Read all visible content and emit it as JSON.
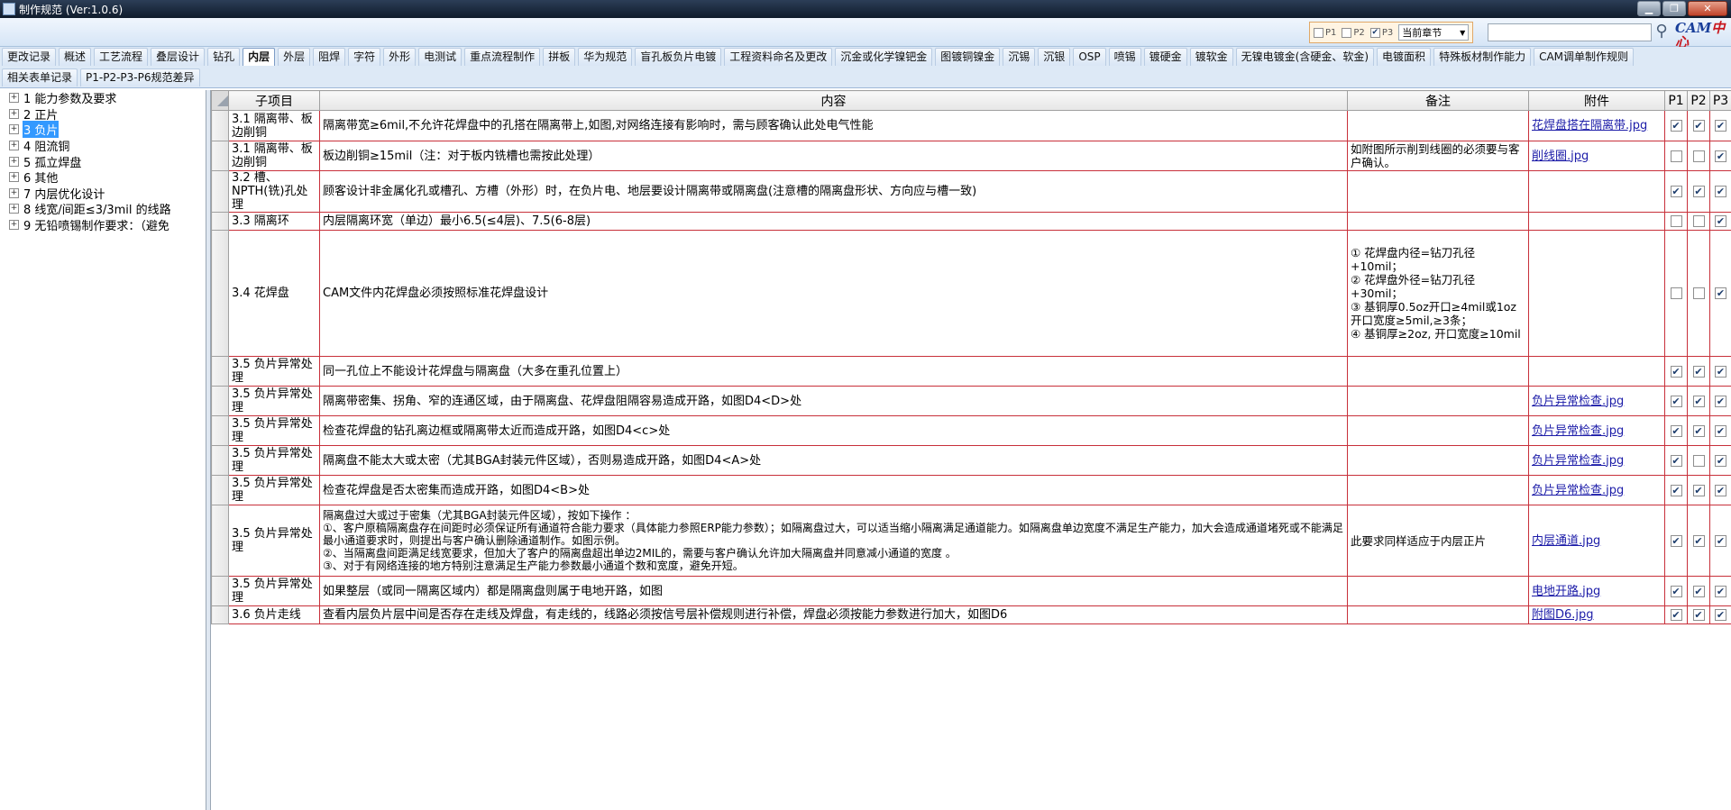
{
  "window": {
    "title": "制作规范 (Ver:1.0.6)"
  },
  "toolbar": {
    "filters": [
      {
        "label": "P1",
        "checked": false
      },
      {
        "label": "P2",
        "checked": false
      },
      {
        "label": "P3",
        "checked": true
      }
    ],
    "chapter_select": "当前章节",
    "search_value": "",
    "logo_text_a": "CAM",
    "logo_text_b": "中心"
  },
  "tabs": {
    "row1": [
      "更改记录",
      "概述",
      "工艺流程",
      "叠层设计",
      "钻孔",
      "内层",
      "外层",
      "阻焊",
      "字符",
      "外形",
      "电测试",
      "重点流程制作",
      "拼板",
      "华为规范",
      "盲孔板负片电镀",
      "工程资料命名及更改",
      "沉金或化学镍钯金",
      "图镀铜镍金",
      "沉锡",
      "沉银",
      "OSP",
      "喷锡",
      "镀硬金",
      "镀软金",
      "无镍电镀金(含硬金、软金)",
      "电镀面积",
      "特殊板材制作能力",
      "CAM调单制作规则"
    ],
    "row2": [
      "相关表单记录",
      "P1-P2-P3-P6规范差异"
    ],
    "active": "内层"
  },
  "tree": {
    "items": [
      {
        "num": "1",
        "label": "能力参数及要求"
      },
      {
        "num": "2",
        "label": "正片"
      },
      {
        "num": "3",
        "label": "负片",
        "selected": true
      },
      {
        "num": "4",
        "label": "阻流铜"
      },
      {
        "num": "5",
        "label": "孤立焊盘"
      },
      {
        "num": "6",
        "label": "其他"
      },
      {
        "num": "7",
        "label": "内层优化设计"
      },
      {
        "num": "8",
        "label": "线宽/间距≤3/3mil 的线路"
      },
      {
        "num": "9",
        "label": "无铅喷锡制作要求：（避免"
      }
    ]
  },
  "grid": {
    "headers": {
      "subitem": "子项目",
      "content": "内容",
      "notes": "备注",
      "attachment": "附件",
      "p1": "P1",
      "p2": "P2",
      "p3": "P3"
    },
    "rows": [
      {
        "subitem": "3.1 隔离带、板边削铜",
        "content": "隔离带宽≥6mil,不允许花焊盘中的孔搭在隔离带上,如图,对网络连接有影响时，需与顾客确认此处电气性能",
        "notes": "",
        "attachment": "花焊盘搭在隔离带.jpg",
        "p1": true,
        "p2": true,
        "p3": true
      },
      {
        "subitem": "3.1 隔离带、板边削铜",
        "content": "板边削铜≥15mil（注：对于板内铣槽也需按此处理）",
        "notes": "如附图所示削到线圈的必须要与客户确认。",
        "attachment": "削线圈.jpg",
        "p1": false,
        "p2": false,
        "p3": true
      },
      {
        "subitem": "3.2 槽、NPTH(铣)孔处理",
        "content": "顾客设计非金属化孔或槽孔、方槽（外形）时，在负片电、地层要设计隔离带或隔离盘(注意槽的隔离盘形状、方向应与槽一致)",
        "notes": "",
        "attachment": "",
        "p1": true,
        "p2": true,
        "p3": true
      },
      {
        "subitem": "3.3 隔离环",
        "content": "内层隔离环宽（单边）最小6.5(≤4层)、7.5(6-8层)",
        "notes": "",
        "attachment": "",
        "p1": false,
        "p2": false,
        "p3": true
      },
      {
        "subitem": "3.4 花焊盘",
        "content": "CAM文件内花焊盘必须按照标准花焊盘设计",
        "notes": "① 花焊盘内径=钻刀孔径+10mil；\n② 花焊盘外径=钻刀孔径+30mil；\n③ 基铜厚0.5oz开口≥4mil或1oz开口宽度≥5mil,≥3条；\n④ 基铜厚≥2oz, 开口宽度≥10mil",
        "attachment": "",
        "p1": false,
        "p2": false,
        "p3": true
      },
      {
        "subitem": "3.5 负片异常处理",
        "content": "同一孔位上不能设计花焊盘与隔离盘（大多在重孔位置上）",
        "notes": "",
        "attachment": "",
        "p1": true,
        "p2": true,
        "p3": true
      },
      {
        "subitem": "3.5 负片异常处理",
        "content": "隔离带密集、拐角、窄的连通区域，由于隔离盘、花焊盘阻隔容易造成开路，如图D4<D>处",
        "notes": "",
        "attachment": "负片异常检查.jpg",
        "p1": true,
        "p2": true,
        "p3": true
      },
      {
        "subitem": "3.5 负片异常处理",
        "content": "检查花焊盘的钻孔离边框或隔离带太近而造成开路，如图D4<c>处",
        "notes": "",
        "attachment": "负片异常检查.jpg",
        "p1": true,
        "p2": true,
        "p3": true
      },
      {
        "subitem": "3.5 负片异常处理",
        "content": "隔离盘不能太大或太密（尤其BGA封装元件区域），否则易造成开路，如图D4<A>处",
        "notes": "",
        "attachment": "负片异常检查.jpg",
        "p1": true,
        "p2": false,
        "p3": true
      },
      {
        "subitem": "3.5 负片异常处理",
        "content": "检查花焊盘是否太密集而造成开路，如图D4<B>处",
        "notes": "",
        "attachment": "负片异常检查.jpg",
        "p1": true,
        "p2": true,
        "p3": true
      },
      {
        "subitem": "3.5 负片异常处理",
        "content": "隔离盘过大或过于密集（尤其BGA封装元件区域），按如下操作 ：\n①、客户原稿隔离盘存在间距时必须保证所有通道符合能力要求（具体能力参照ERP能力参数）；如隔离盘过大，可以适当缩小隔离满足通道能力。如隔离盘单边宽度不满足生产能力，加大会造成通道堵死或不能满足最小通道要求时，则提出与客户确认删除通道制作。如图示例。\n②、当隔离盘间距满足线宽要求，但加大了客户的隔离盘超出单边2MIL的，需要与客户确认允许加大隔离盘并同意减小通道的宽度 。\n③、对于有网络连接的地方特别注意满足生产能力参数最小通道个数和宽度，避免开短。",
        "notes": "此要求同样适应于内层正片",
        "attachment": "内层通道.jpg",
        "p1": true,
        "p2": true,
        "p3": true
      },
      {
        "subitem": "3.5 负片异常处理",
        "content": "如果整层（或同一隔离区域内）都是隔离盘则属于电地开路，如图",
        "notes": "",
        "attachment": "电地开路.jpg",
        "p1": true,
        "p2": true,
        "p3": true
      },
      {
        "subitem": "3.6 负片走线",
        "content": "查看内层负片层中间是否存在走线及焊盘，有走线的，线路必须按信号层补偿规则进行补偿，焊盘必须按能力参数进行加大，如图D6",
        "notes": "",
        "attachment": "附图D6.jpg",
        "p1": true,
        "p2": true,
        "p3": true
      }
    ]
  }
}
